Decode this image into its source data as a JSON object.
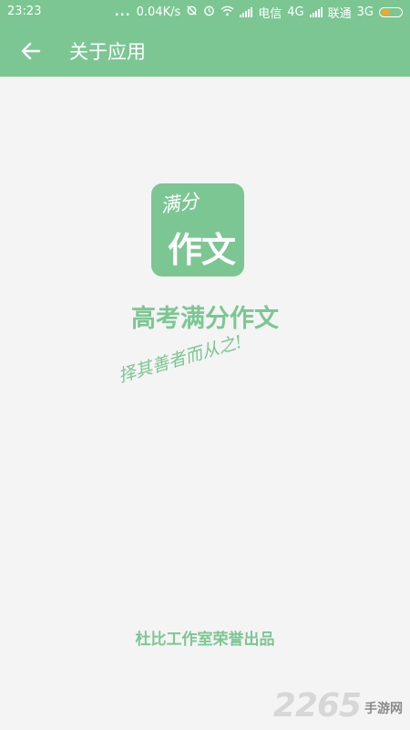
{
  "status_bar": {
    "time": "23:23",
    "dots": "...",
    "speed": "0.04K/s",
    "carrier1": "电信",
    "net1": "4G",
    "carrier2": "联通",
    "net2": "3G",
    "battery_level": 0.4,
    "icons": [
      "sync-off-icon",
      "alarm-icon",
      "wifi-icon",
      "signal-icon",
      "battery-icon"
    ]
  },
  "app_bar": {
    "back_icon": "arrow-left-icon",
    "title": "关于应用",
    "color": "#7cc693"
  },
  "about": {
    "logo_top": "满分",
    "logo_main": "作文",
    "app_name": "高考满分作文",
    "slogan": "择其善者而从之!",
    "credit": "杜比工作室荣誉出品"
  },
  "watermark": {
    "number": "2265",
    "text": "手游网"
  }
}
